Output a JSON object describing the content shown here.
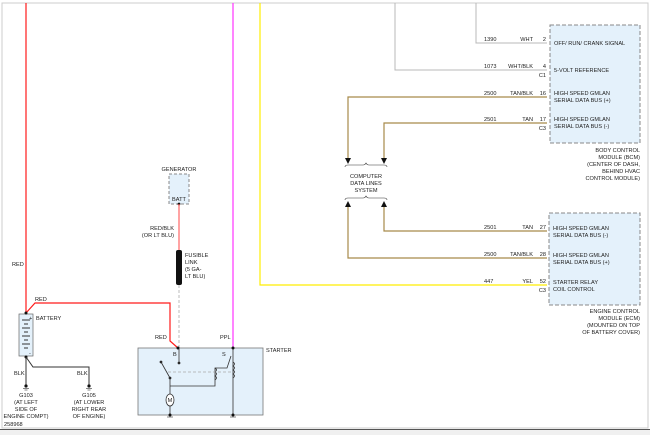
{
  "diagram_id": "258968",
  "colors": {
    "red": "#ff1a1a",
    "magenta": "#ff33ff",
    "yellow": "#ffee00",
    "tan": "#a68a4a",
    "gray": "#b8b8b8",
    "module_fill": "#e4f1fb"
  },
  "bcm": {
    "pins": [
      {
        "circuit": "1390",
        "color": "WHT",
        "pin": "2",
        "function": [
          "OFF/ RUN/ CRANK SIGNAL"
        ]
      },
      {
        "circuit": "1073",
        "color": "WHT/BLK",
        "pin": "4",
        "connector": "C1",
        "function": [
          "5-VOLT REFERENCE"
        ]
      },
      {
        "circuit": "2500",
        "color": "TAN/BLK",
        "pin": "16",
        "function": [
          "HIGH SPEED GMLAN",
          "SERIAL DATA BUS (+)"
        ]
      },
      {
        "circuit": "2501",
        "color": "TAN",
        "pin": "17",
        "connector": "C3",
        "function": [
          "HIGH SPEED GMLAN",
          "SERIAL DATA BUS (-)"
        ]
      }
    ],
    "label": [
      "BODY CONTROL",
      "MODULE (BCM)",
      "(CENTER OF DASH,",
      "BEHIND HVAC",
      "CONTROL MODULE)"
    ]
  },
  "data_lines": [
    "COMPUTER",
    "DATA LINES",
    "SYSTEM"
  ],
  "ecm": {
    "pins": [
      {
        "circuit": "2501",
        "color": "TAN",
        "pin": "27",
        "function": [
          "HIGH SPEED GMLAN",
          "SERIAL DATA BUS (-)"
        ]
      },
      {
        "circuit": "2500",
        "color": "TAN/BLK",
        "pin": "28",
        "function": [
          "HIGH SPEED GMLAN",
          "SERIAL DATA BUS (+)"
        ]
      },
      {
        "circuit": "447",
        "color": "YEL",
        "pin": "52",
        "connector": "C3",
        "function": [
          "STARTER RELAY",
          "COIL CONTROL"
        ]
      }
    ],
    "label": [
      "ENGINE CONTROL",
      "MODULE (ECM)",
      "(MOUNTED ON TOP",
      "OF BATTERY COVER)"
    ]
  },
  "generator": {
    "label": "GENERATOR",
    "terminal": "BATT",
    "wire": [
      "RED/BLK",
      "(OR LT BLU)"
    ]
  },
  "fusible_link": [
    "FUSIBLE",
    "LINK",
    "(5 GA-",
    "LT BLU)"
  ],
  "battery": {
    "label": "BATTERY",
    "plus": "+",
    "minus": "-"
  },
  "wires": {
    "red_main": "RED",
    "red_batt": "RED",
    "red_starter": "RED",
    "ppl": "PPL",
    "blk1": "BLK",
    "blk2": "BLK"
  },
  "starter": {
    "label": "STARTER",
    "b": "B",
    "s": "S",
    "motor": "M"
  },
  "grounds": [
    {
      "name": "G103",
      "desc": [
        "(AT LEFT",
        "SIDE OF",
        "ENGINE COMPT)"
      ]
    },
    {
      "name": "G105",
      "desc": [
        "(AT LOWER",
        "RIGHT REAR",
        "OF ENGINE)"
      ]
    }
  ]
}
